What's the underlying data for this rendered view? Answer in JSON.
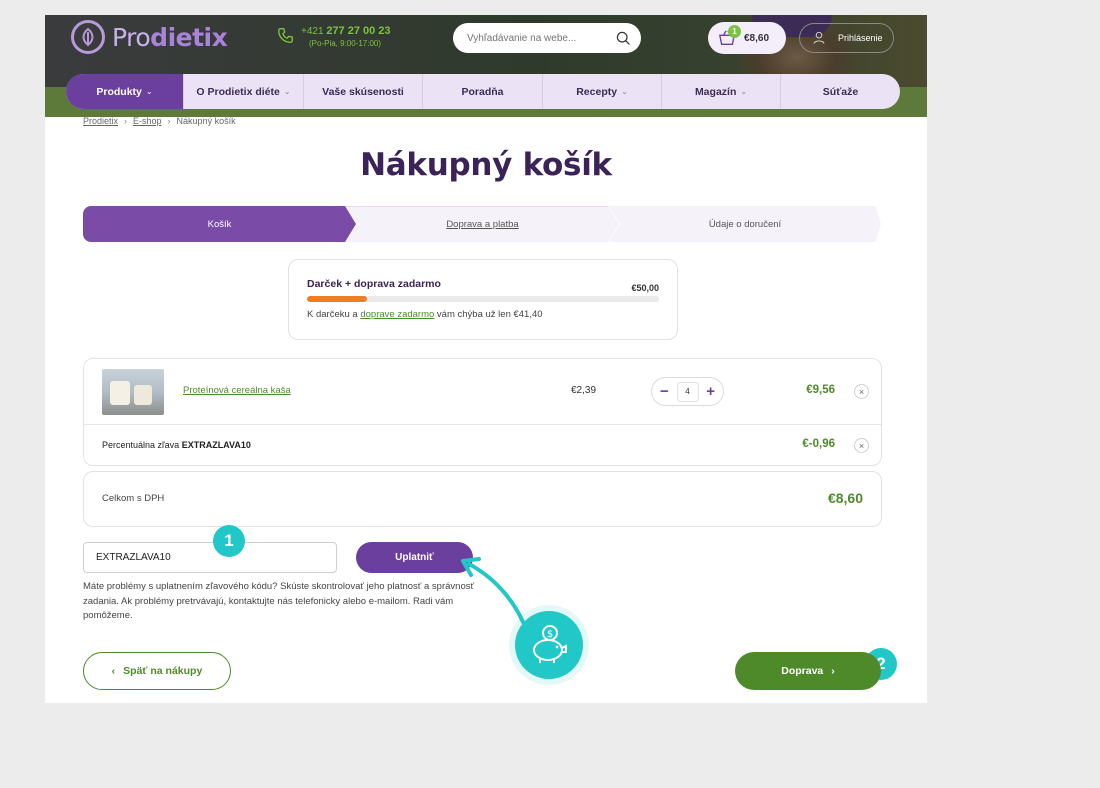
{
  "header": {
    "logo_text_light": "Pro",
    "logo_text_bold": "dietix",
    "phone_prefix": "+421",
    "phone_number": "277 27 00 23",
    "phone_hours": "(Po-Pia, 9:00-17:00)",
    "search_placeholder": "Vyhľadávanie na webe...",
    "cart_count": "1",
    "cart_total": "€8,60",
    "login_label": "Prihlásenie"
  },
  "nav": {
    "items": [
      {
        "label": "Produkty",
        "chevron": "⌄"
      },
      {
        "label": "O Prodietix diéte",
        "chevron": "⌄"
      },
      {
        "label": "Vaše skúsenosti",
        "chevron": ""
      },
      {
        "label": "Poradňa",
        "chevron": ""
      },
      {
        "label": "Recepty",
        "chevron": "⌄"
      },
      {
        "label": "Magazín",
        "chevron": "⌄"
      },
      {
        "label": "Súťaže",
        "chevron": ""
      }
    ]
  },
  "breadcrumb": {
    "items": [
      "Prodietix",
      "E-shop",
      "Nákupný košík"
    ]
  },
  "page_title": "Nákupný košík",
  "steps": [
    "Košík",
    "Doprava a platba",
    "Údaje o doručení"
  ],
  "gift": {
    "title": "Darček + doprava zadarmo",
    "threshold": "€50,00",
    "progress_fraction": 0.17,
    "note_prefix": "K darčeku a ",
    "note_link": "doprave zadarmo",
    "note_suffix": " vám chýba už len €41,40"
  },
  "cart": {
    "product": {
      "name": "Proteínová cereálna kaša",
      "unit_price": "€2,39",
      "quantity": "4",
      "minus": "−",
      "plus": "+",
      "line_total": "€9,56",
      "remove": "×"
    },
    "discount": {
      "label": "Percentuálna zľava ",
      "code": "EXTRAZLAVA10",
      "value": "€-0,96",
      "remove": "×"
    },
    "total_label": "Celkom s DPH",
    "total_value": "€8,60"
  },
  "coupon": {
    "value": "EXTRAZLAVA10",
    "apply_label": "Uplatniť",
    "help_text": "Máte problémy s uplatnením zľavového kódu? Skúste skontrolovať jeho platnosť a správnosť zadania. Ak problémy pretrvávajú, kontaktujte nás telefonicky alebo e-mailom. Radi vám pomôžeme."
  },
  "badges": {
    "one": "1",
    "two": "2"
  },
  "buttons": {
    "back_label": "Späť na nákupy",
    "back_chevron": "‹",
    "next_label": "Doprava",
    "next_chevron": "›"
  },
  "colors": {
    "brand_purple": "#6b3f9e",
    "brand_green": "#4f8a2a",
    "accent_cyan": "#22c7c7",
    "progress_orange": "#ef7d22"
  },
  "icons": [
    "leaf-logo-icon",
    "phone-icon",
    "search-icon",
    "cart-basket-icon",
    "user-icon",
    "chevron-down-icon",
    "close-icon",
    "piggy-bank-icon",
    "arrow-icon"
  ]
}
